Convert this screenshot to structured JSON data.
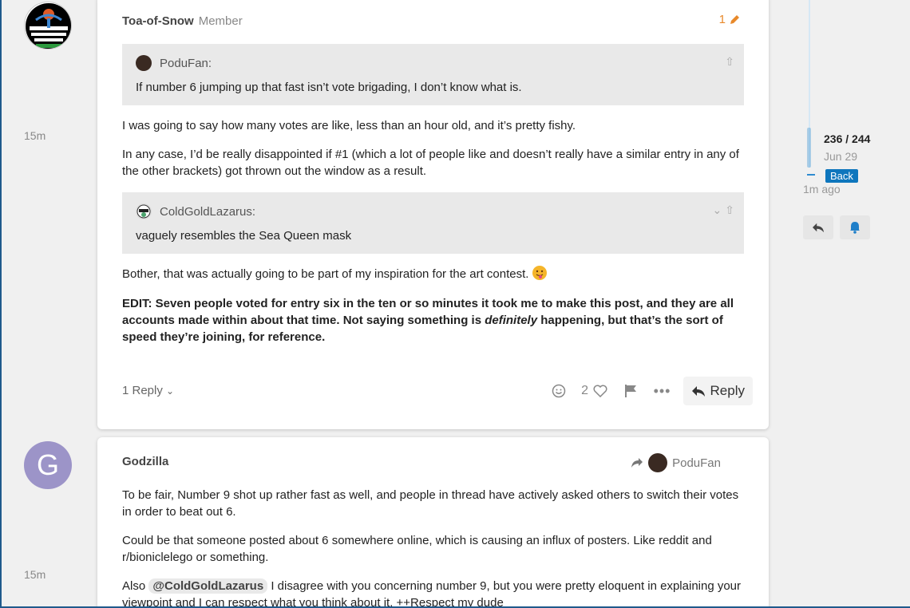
{
  "post1": {
    "time": "15m",
    "author": "Toa-of-Snow",
    "role": "Member",
    "edit_count": "1",
    "quote1": {
      "author": "PoduFan:",
      "text": "If number 6 jumping up that fast isn’t vote brigading, I don’t know what is."
    },
    "para1": "I was going to say how many votes are like, less than an hour old, and it’s pretty fishy.",
    "para2": "In any case, I’d be really disappointed if #1 (which a lot of people like and doesn’t really have a similar entry in any of the other brackets) got thrown out the window as a result.",
    "quote2": {
      "author": "ColdGoldLazarus:",
      "text": "vaguely resembles the Sea Queen mask"
    },
    "para3": "Bother, that was actually going to be part of my inspiration for the art contest.",
    "edit_prefix": "EDIT: Seven people voted for entry six in the ten or so minutes it took me to make this post, and they are all accounts made within about that time. Not saying something is ",
    "edit_emph": "definitely",
    "edit_suffix": " happening, but that’s the sort of speed they’re joining, for reference.",
    "replies": "1 Reply",
    "like_count": "2",
    "reply_label": "Reply"
  },
  "post2": {
    "time": "15m",
    "avatar_letter": "G",
    "author": "Godzilla",
    "reply_to": "PoduFan",
    "para1": "To be fair, Number 9 shot up rather fast as well, and people in thread have actively asked others to switch their votes in order to beat out 6.",
    "para2": "Could be that someone posted about 6 somewhere online, which is causing an influx of posters. Like reddit and r/bioniclelego or something.",
    "para3_prefix": "Also ",
    "mention": "@ColdGoldLazarus",
    "para3_suffix": " I disagree with you concerning number 9, but you were pretty eloquent in explaining your viewpoint and I can respect what you think about it. ++Respect my dude"
  },
  "timeline": {
    "position": "236 / 244",
    "date": "Jun 29",
    "back": "Back",
    "ago": "1m ago"
  },
  "colors": {
    "accent": "#0e76bd",
    "edit": "#e8892a",
    "avatar_g": "#9c94c8"
  }
}
